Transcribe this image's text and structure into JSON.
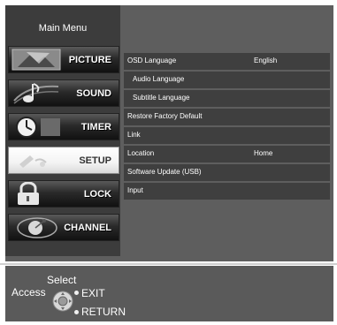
{
  "menu": {
    "title": "Main Menu",
    "items": [
      {
        "label": "PICTURE",
        "icon": "picture-icon"
      },
      {
        "label": "SOUND",
        "icon": "music-note-icon"
      },
      {
        "label": "TIMER",
        "icon": "clock-icon"
      },
      {
        "label": "SETUP",
        "icon": "setup-icon",
        "selected": true
      },
      {
        "label": "LOCK",
        "icon": "padlock-icon"
      },
      {
        "label": "CHANNEL",
        "icon": "satellite-dish-icon"
      }
    ]
  },
  "setup": {
    "rows": [
      {
        "label": "OSD Language",
        "value": "English"
      },
      {
        "label": "Audio Language",
        "value": ""
      },
      {
        "label": "Subtitle Language",
        "value": ""
      },
      {
        "label": "Restore Factory Default",
        "value": ""
      },
      {
        "label": "Link",
        "value": ""
      },
      {
        "label": "Location",
        "value": "Home"
      },
      {
        "label": "Software Update (USB)",
        "value": ""
      },
      {
        "label": "Input",
        "value": ""
      }
    ]
  },
  "footer": {
    "select": "Select",
    "access": "Access",
    "exit": "EXIT",
    "return": "RETURN"
  },
  "colors": {
    "screen_bg": "#5e5e5e",
    "sidebar_bg": "#3c3c3c",
    "row_bg": "#3f3f3f"
  }
}
